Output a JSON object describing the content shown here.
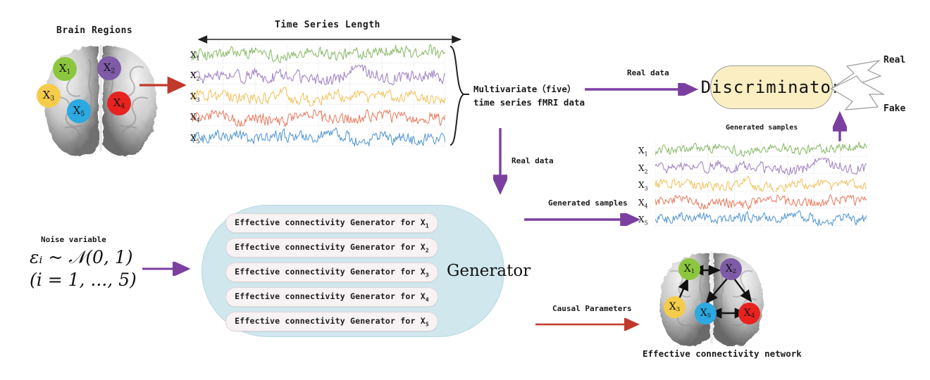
{
  "figure": {
    "title_left": "Brain Regions",
    "timeseries_header": "Time Series Length",
    "center_caption_line1": "Multivariate（five）",
    "center_caption_line2": "time series fMRI data",
    "network_caption": "Effective connectivity network"
  },
  "regions": {
    "nodes": [
      {
        "id": "X1",
        "label": "X",
        "sub": "1",
        "color": "#8cc63f"
      },
      {
        "id": "X2",
        "label": "X",
        "sub": "2",
        "color": "#7d5ba6"
      },
      {
        "id": "X3",
        "label": "X",
        "sub": "3",
        "color": "#f5cc4a"
      },
      {
        "id": "X4",
        "label": "X",
        "sub": "4",
        "color": "#e8231f"
      },
      {
        "id": "X5",
        "label": "X",
        "sub": "5",
        "color": "#2ba9e0"
      }
    ]
  },
  "series_labels": [
    {
      "label": "X",
      "sub": "1",
      "color": "#8fbc6e"
    },
    {
      "label": "X",
      "sub": "2",
      "color": "#a487c6"
    },
    {
      "label": "X",
      "sub": "3",
      "color": "#f2c464"
    },
    {
      "label": "X",
      "sub": "4",
      "color": "#e8836a"
    },
    {
      "label": "X",
      "sub": "5",
      "color": "#5b9bd5"
    }
  ],
  "generator": {
    "title": "Generator",
    "pills": [
      {
        "text": "Effective connectivity Generator for X",
        "sub": "1"
      },
      {
        "text": "Effective connectivity Generator for X",
        "sub": "2"
      },
      {
        "text": "Effective connectivity Generator for X",
        "sub": "3"
      },
      {
        "text": "Effective connectivity Generator for X",
        "sub": "4"
      },
      {
        "text": "Effective connectivity Generator for X",
        "sub": "5"
      }
    ]
  },
  "discriminator": {
    "title": "Discriminator",
    "outputs": [
      {
        "label": "Real"
      },
      {
        "label": "Fake"
      }
    ]
  },
  "noise": {
    "caption": "Noise variable",
    "formula_line1": "εᵢ ~ 𝒩(0, 1)",
    "formula_line2": "(i = 1, ..., 5)"
  },
  "arrow_labels": {
    "real_data_top": "Real data",
    "real_data_down": "Real data",
    "generated_samples_right": "Generated samples",
    "generated_samples_up": "Generated samples",
    "causal_parameters": "Causal Parameters"
  },
  "network_edges": [
    {
      "from": "X3",
      "to": "X1",
      "type": "directed"
    },
    {
      "from": "X1",
      "to": "X2",
      "type": "bidirectional"
    },
    {
      "from": "X2",
      "to": "X5",
      "type": "directed"
    },
    {
      "from": "X2",
      "to": "X4",
      "type": "directed"
    },
    {
      "from": "X5",
      "to": "X4",
      "type": "bidirectional"
    }
  ],
  "colors": {
    "purple_arrow": "#7b3fa0",
    "red_arrow": "#c0392b",
    "black_arrow": "#222222",
    "generator_fill": "#cfe7ed",
    "discriminator_fill": "#faeec2",
    "pill_fill": "#f7f2f4"
  }
}
